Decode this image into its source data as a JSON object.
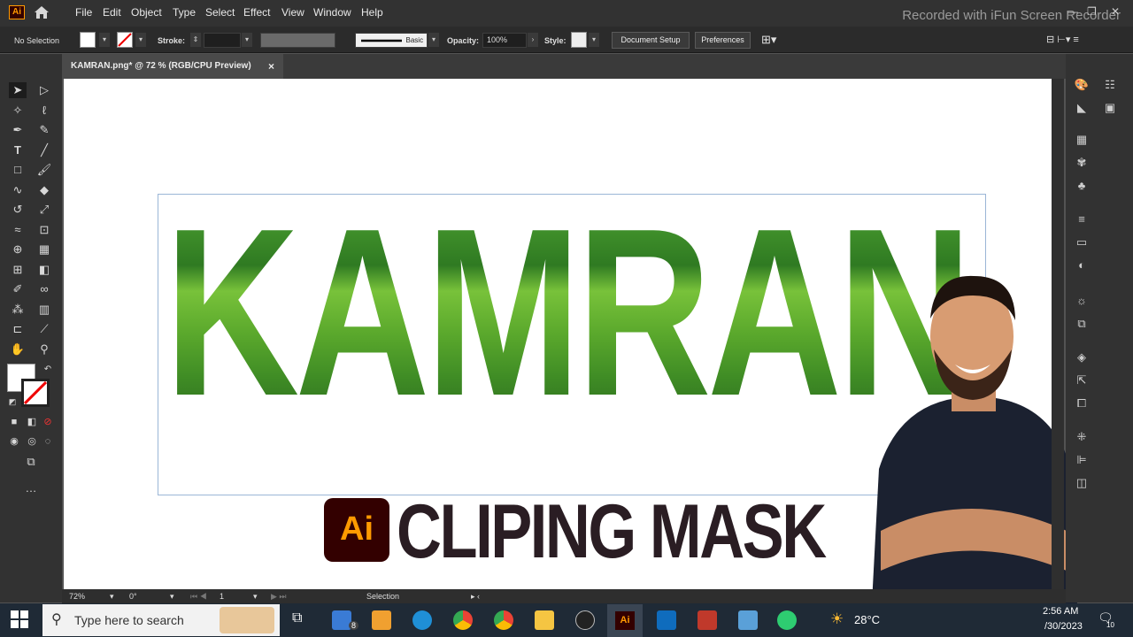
{
  "menubar": {
    "logo": "Ai",
    "items": [
      "File",
      "Edit",
      "Object",
      "Type",
      "Select",
      "Effect",
      "View",
      "Window",
      "Help"
    ],
    "watermark": "Recorded with iFun Screen Recorder"
  },
  "controlbar": {
    "selection": "No Selection",
    "stroke_label": "Stroke:",
    "brush_label": "Basic",
    "opacity_label": "Opacity:",
    "opacity_value": "100%",
    "style_label": "Style:",
    "doc_setup": "Document Setup",
    "preferences": "Preferences"
  },
  "document": {
    "tab_title": "KAMRAN.png* @ 72 % (RGB/CPU Preview)",
    "close_glyph": "×"
  },
  "artwork": {
    "masked_text": "KAMRAN",
    "badge": "Ai",
    "title": "CLIPING MASK"
  },
  "statusbar": {
    "zoom": "72%",
    "rotate": "0°",
    "artboard": "1",
    "tool": "Selection"
  },
  "taskbar": {
    "search_placeholder": "Type here to search",
    "mail_badge": "8",
    "weather": "28°C",
    "time": "2:56 AM",
    "date": "/30/2023",
    "notif": "10"
  },
  "colors": {
    "ai_orange": "#ff9a00",
    "ai_bg": "#330000",
    "title": "#2a1d23"
  }
}
